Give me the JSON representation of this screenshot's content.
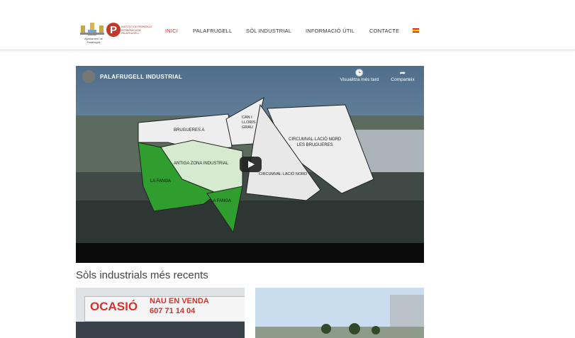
{
  "header": {
    "logo_left_text": "Ajuntament de Palafrugell",
    "logo_right_text": "INSTITUT DE PROMOCIÓ ECONÒMICA DE PALAFRUGELL",
    "nav": [
      {
        "label": "INICI",
        "active": true
      },
      {
        "label": "PALAFRUGELL",
        "active": false
      },
      {
        "label": "SÒL INDUSTRIAL",
        "active": false
      },
      {
        "label": "INFORMACIÓ ÚTIL",
        "active": false
      },
      {
        "label": "CONTACTE",
        "active": false
      }
    ],
    "language_flag": "es-flag-icon"
  },
  "video": {
    "title": "PALAFRUGELL INDUSTRIAL",
    "watch_later": "Visualitza més tard",
    "share": "Comparteix",
    "map_labels": {
      "bruguere": "BRUGUERES A",
      "can_ilco": "CAN I\nLLORIS\nGRAU",
      "circumval_nord": "CIRCUMVAL·LACIÓ NORD\nLES BRUGUERES",
      "antiga": "ANTIGA ZONA INDUSTRIAL",
      "circ_nord": "CIRCUMVAL·LACIÓ NORD",
      "la_fanga1": "LA FANGA",
      "la_fanga2": "LA FANGA"
    }
  },
  "section": {
    "title": "Sòls industrials més recents"
  },
  "cards": [
    {
      "sign_main": "OCASIÓ",
      "sign_sub": "NAU EN VENDA",
      "sign_phone": "607 71 14 04"
    },
    {
      "image": "industrial building with trees"
    }
  ],
  "colors": {
    "accent": "#d9302a",
    "green_dark": "#2f9e2f",
    "green_light": "#d6ead0"
  }
}
